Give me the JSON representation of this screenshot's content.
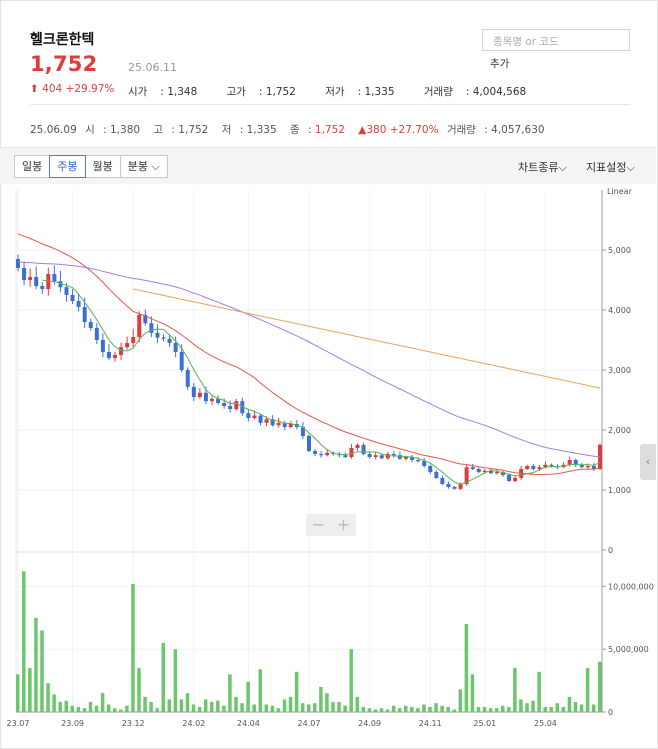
{
  "header": {
    "name": "헬크론한텍",
    "price": "1,752",
    "date": "25.06.11",
    "change": "404 +29.97%",
    "open_label": "시가",
    "open": "1,348",
    "high_label": "고가",
    "high": "1,752",
    "low_label": "저가",
    "low": "1,335",
    "volume_label": "거래량",
    "volume": "4,004,568"
  },
  "search": {
    "placeholder": "종목명 or 코드",
    "add_label": "추가"
  },
  "prev_day": {
    "date": "25.06.09",
    "open_label": "시",
    "open": "1,380",
    "high_label": "고",
    "high": "1,752",
    "low_label": "저",
    "low": "1,335",
    "close_label": "종",
    "close": "1,752",
    "change": "▲380 +27.70%",
    "volume_label": "거래량",
    "volume": "4,057,630"
  },
  "toolbar": {
    "tabs": [
      "일봉",
      "주봉",
      "월봉",
      "분봉"
    ],
    "active_tab": "주봉",
    "chart_type": "차트종류",
    "indicator": "지표설정"
  },
  "chart_data": {
    "type": "candlestick",
    "scale_label": "Linear",
    "price_ticks": [
      0,
      1000,
      2000,
      3000,
      4000,
      5000
    ],
    "price_tick_labels": [
      "0",
      "1,000",
      "2,000",
      "3,000",
      "4,000",
      "5,000"
    ],
    "volume_ticks": [
      0,
      5000000,
      10000000
    ],
    "volume_tick_labels": [
      "0",
      "5,000,000",
      "10,000,000"
    ],
    "x_labels": [
      "23.07",
      "23.09",
      "23.12",
      "24.02",
      "24.04",
      "24.07",
      "24.09",
      "24.11",
      "25.01",
      "25.04"
    ],
    "label_index": [
      0,
      9,
      19,
      29,
      38,
      48,
      58,
      68,
      77,
      87
    ],
    "colors": {
      "up": "#e03b3b",
      "down": "#3c6fd6",
      "ma5": "#56b356",
      "ma20": "#e05a4a",
      "ma60": "#a47cea",
      "ma120": "#f0a060",
      "volume": "#6cc76c"
    },
    "closes": [
      4700,
      4500,
      4550,
      4400,
      4350,
      4600,
      4480,
      4380,
      4250,
      4150,
      4050,
      3800,
      3700,
      3500,
      3300,
      3200,
      3250,
      3380,
      3450,
      3550,
      3920,
      3780,
      3620,
      3540,
      3520,
      3450,
      3300,
      3000,
      2720,
      2550,
      2620,
      2480,
      2520,
      2450,
      2400,
      2350,
      2480,
      2280,
      2200,
      2240,
      2120,
      2180,
      2080,
      2120,
      2050,
      2100,
      2050,
      1900,
      1650,
      1600,
      1580,
      1620,
      1600,
      1580,
      1550,
      1700,
      1750,
      1600,
      1550,
      1580,
      1530,
      1600,
      1580,
      1520,
      1550,
      1500,
      1480,
      1400,
      1300,
      1200,
      1100,
      1050,
      1020,
      1100,
      1380,
      1350,
      1300,
      1320,
      1280,
      1300,
      1250,
      1150,
      1200,
      1350,
      1400,
      1350,
      1380,
      1420,
      1400,
      1380,
      1420,
      1500,
      1420,
      1380,
      1400,
      1350,
      1752
    ],
    "volumes": [
      3000000,
      11200000,
      3500000,
      7500000,
      6500000,
      2300000,
      1400000,
      800000,
      900000,
      500000,
      400000,
      300000,
      800000,
      500000,
      1500000,
      600000,
      300000,
      200000,
      500000,
      10200000,
      3500000,
      1200000,
      800000,
      300000,
      5500000,
      1000000,
      5000000,
      1000000,
      1500000,
      600000,
      400000,
      1000000,
      800000,
      900000,
      500000,
      3000000,
      1200000,
      700000,
      2400000,
      600000,
      3400000,
      600000,
      500000,
      300000,
      1000000,
      1200000,
      3200000,
      700000,
      600000,
      700000,
      2000000,
      1500000,
      800000,
      800000,
      500000,
      5000000,
      1200000,
      400000,
      300000,
      200000,
      300000,
      200000,
      500000,
      300000,
      500000,
      400000,
      300000,
      600000,
      400000,
      700000,
      500000,
      400000,
      200000,
      1800000,
      7000000,
      3000000,
      400000,
      400000,
      300000,
      300000,
      500000,
      400000,
      3500000,
      1000000,
      700000,
      900000,
      3200000,
      400000,
      400000,
      700000,
      400000,
      1200000,
      800000,
      600000,
      3500000,
      600000,
      4000000
    ]
  }
}
